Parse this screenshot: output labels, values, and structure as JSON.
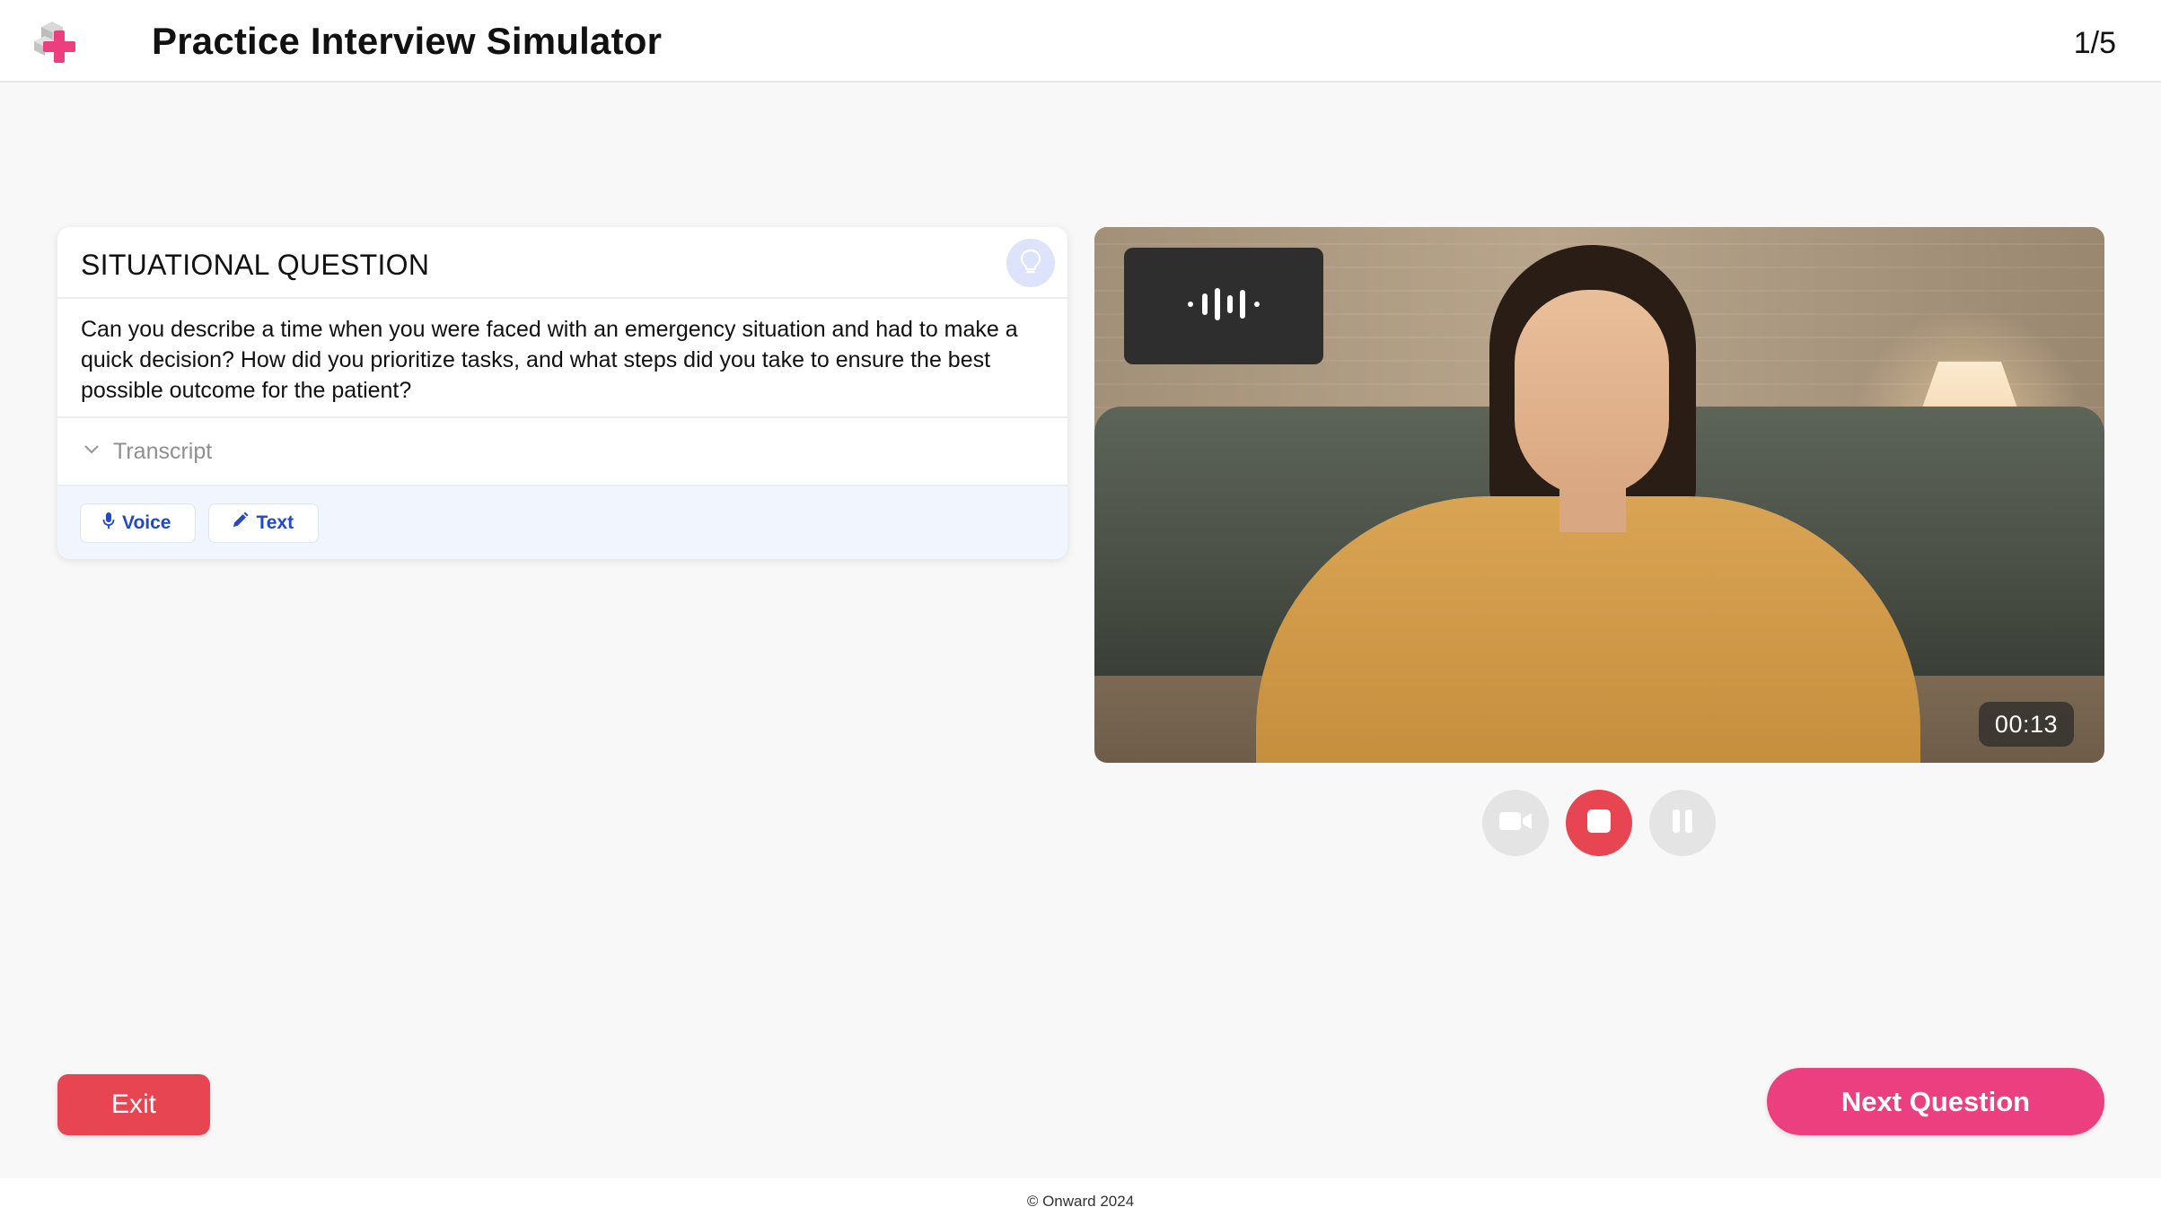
{
  "header": {
    "title": "Practice Interview Simulator",
    "progress": "1/5",
    "logo_icon": "medical-cross-logo-icon"
  },
  "question_card": {
    "category": "SITUATIONAL QUESTION",
    "hint_icon": "lightbulb-icon",
    "text": "Can you describe a time when you were faced with an emergency situation and had to make a quick decision? How did you prioritize tasks, and what steps did you take to ensure the best possible outcome for the patient?",
    "transcript_label": "Transcript",
    "modes": [
      {
        "label": "Voice",
        "icon": "microphone-icon"
      },
      {
        "label": "Text",
        "icon": "pencil-icon"
      }
    ]
  },
  "video": {
    "timer": "00:13",
    "audio_icon": "audio-waveform-icon"
  },
  "controls": {
    "camera_icon": "video-camera-icon",
    "stop_icon": "stop-icon",
    "pause_icon": "pause-icon"
  },
  "actions": {
    "exit_label": "Exit",
    "next_label": "Next Question"
  },
  "footer": {
    "copyright": "© Onward 2024"
  },
  "colors": {
    "accent_pink": "#ec3f7f",
    "danger_red": "#e84553",
    "link_blue": "#2348c8",
    "hint_bg": "#dde3fb"
  }
}
